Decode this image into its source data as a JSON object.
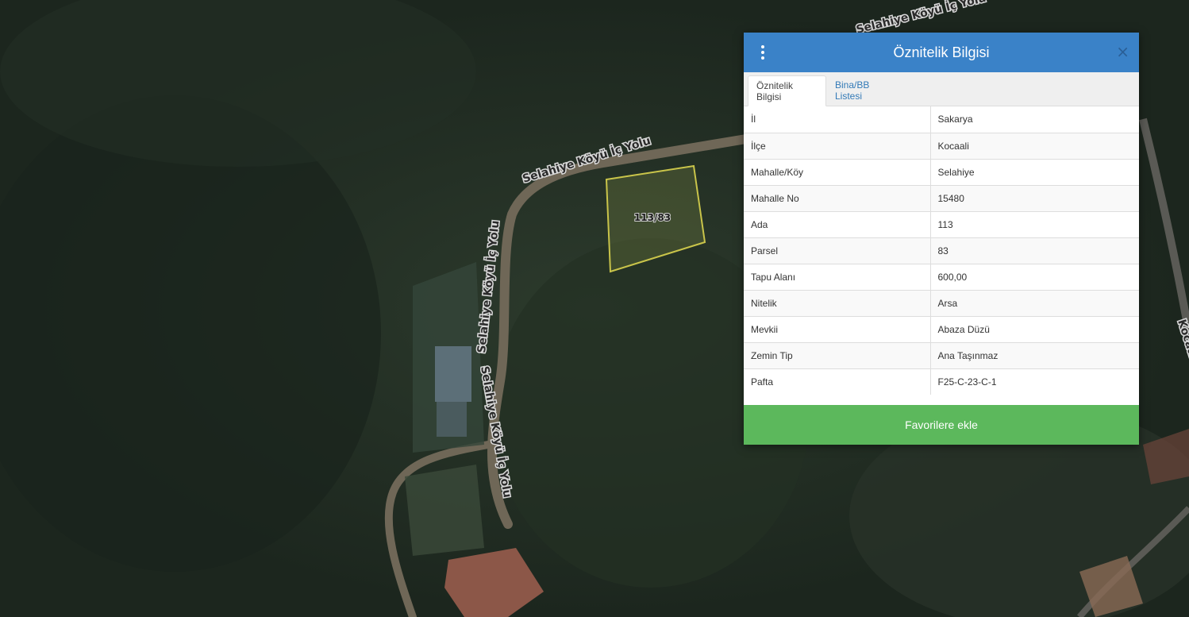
{
  "map": {
    "road_labels": [
      "Selahiye Köyü İç Yolu",
      "Selahiye Köyü İç Yolu",
      "Selahiye Köyü İç Yolu",
      "Kocaali"
    ],
    "parcel_label": "113/83",
    "colors": {
      "vegetation": "#1f2a22",
      "road": "#8a7f6a",
      "parcel_outline": "#c9c44a"
    }
  },
  "panel": {
    "title": "Öznitelik Bilgisi",
    "menu_icon": "vertical-ellipsis-icon",
    "close_label": "×",
    "tabs": [
      {
        "label": "Öznitelik Bilgisi",
        "active": true
      },
      {
        "label": "Bina/BB Listesi",
        "active": false
      }
    ],
    "rows": [
      {
        "key": "İl",
        "value": "Sakarya"
      },
      {
        "key": "İlçe",
        "value": "Kocaali"
      },
      {
        "key": "Mahalle/Köy",
        "value": "Selahiye"
      },
      {
        "key": "Mahalle No",
        "value": "15480"
      },
      {
        "key": "Ada",
        "value": "113"
      },
      {
        "key": "Parsel",
        "value": "83"
      },
      {
        "key": "Tapu Alanı",
        "value": "600,00"
      },
      {
        "key": "Nitelik",
        "value": "Arsa"
      },
      {
        "key": "Mevkii",
        "value": "Abaza Düzü"
      },
      {
        "key": "Zemin Tip",
        "value": "Ana Taşınmaz"
      },
      {
        "key": "Pafta",
        "value": "F25-C-23-C-1"
      }
    ],
    "favorite_button": "Favorilere ekle",
    "colors": {
      "header": "#3a82c8",
      "button": "#5cb85c",
      "tab_link": "#337ab7"
    }
  }
}
